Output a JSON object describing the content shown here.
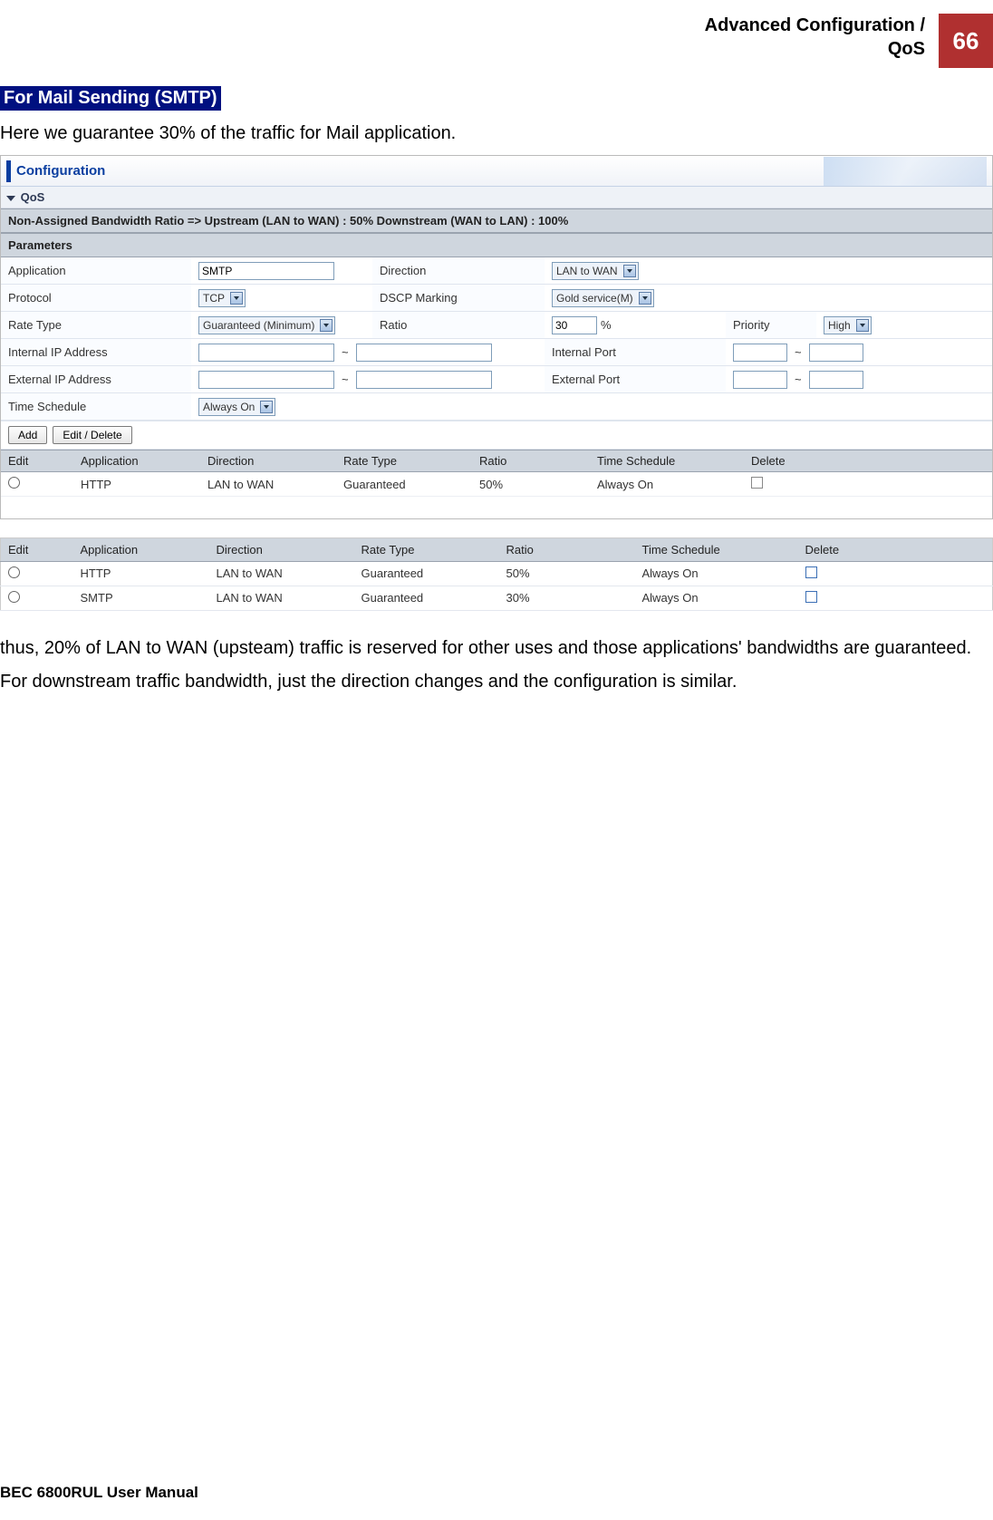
{
  "header": {
    "title_line1": "Advanced Configuration /",
    "title_line2": "QoS",
    "page_number": "66"
  },
  "section": {
    "heading": "For Mail Sending (SMTP)",
    "intro": "Here we guarantee 30% of the traffic for Mail application."
  },
  "panel": {
    "banner": "Configuration",
    "qos_label": "QoS",
    "bandwidth_row": "Non-Assigned Bandwidth Ratio => Upstream (LAN to WAN) : 50%     Downstream (WAN to LAN) : 100%",
    "parameters_label": "Parameters",
    "fields": {
      "application_label": "Application",
      "application_value": "SMTP",
      "direction_label": "Direction",
      "direction_value": "LAN to WAN",
      "protocol_label": "Protocol",
      "protocol_value": "TCP",
      "dscp_label": "DSCP Marking",
      "dscp_value": "Gold service(M)",
      "rate_type_label": "Rate Type",
      "rate_type_value": "Guaranteed (Minimum)",
      "ratio_label": "Ratio",
      "ratio_value": "30",
      "ratio_unit": "%",
      "priority_label": "Priority",
      "priority_value": "High",
      "internal_ip_label": "Internal IP Address",
      "internal_port_label": "Internal Port",
      "external_ip_label": "External IP Address",
      "external_port_label": "External Port",
      "time_schedule_label": "Time Schedule",
      "time_schedule_value": "Always On"
    },
    "buttons": {
      "add": "Add",
      "edit_delete": "Edit / Delete"
    },
    "inner_table": {
      "headers": [
        "Edit",
        "Application",
        "Direction",
        "Rate Type",
        "Ratio",
        "Time Schedule",
        "Delete"
      ],
      "rows": [
        {
          "application": "HTTP",
          "direction": "LAN to WAN",
          "rate_type": "Guaranteed",
          "ratio": "50%",
          "time_schedule": "Always On"
        }
      ]
    }
  },
  "standalone_table": {
    "headers": [
      "Edit",
      "Application",
      "Direction",
      "Rate Type",
      "Ratio",
      "Time Schedule",
      "Delete"
    ],
    "rows": [
      {
        "application": "HTTP",
        "direction": "LAN to WAN",
        "rate_type": "Guaranteed",
        "ratio": "50%",
        "time_schedule": "Always On"
      },
      {
        "application": "SMTP",
        "direction": "LAN to WAN",
        "rate_type": "Guaranteed",
        "ratio": "30%",
        "time_schedule": "Always On"
      }
    ]
  },
  "closing": {
    "para1": "thus, 20% of LAN to WAN (upsteam) traffic is reserved for other uses and those applications' bandwidths are guaranteed.",
    "para2": "For downstream traffic bandwidth, just the direction changes and the configuration is similar."
  },
  "footer": "BEC 6800RUL User Manual"
}
